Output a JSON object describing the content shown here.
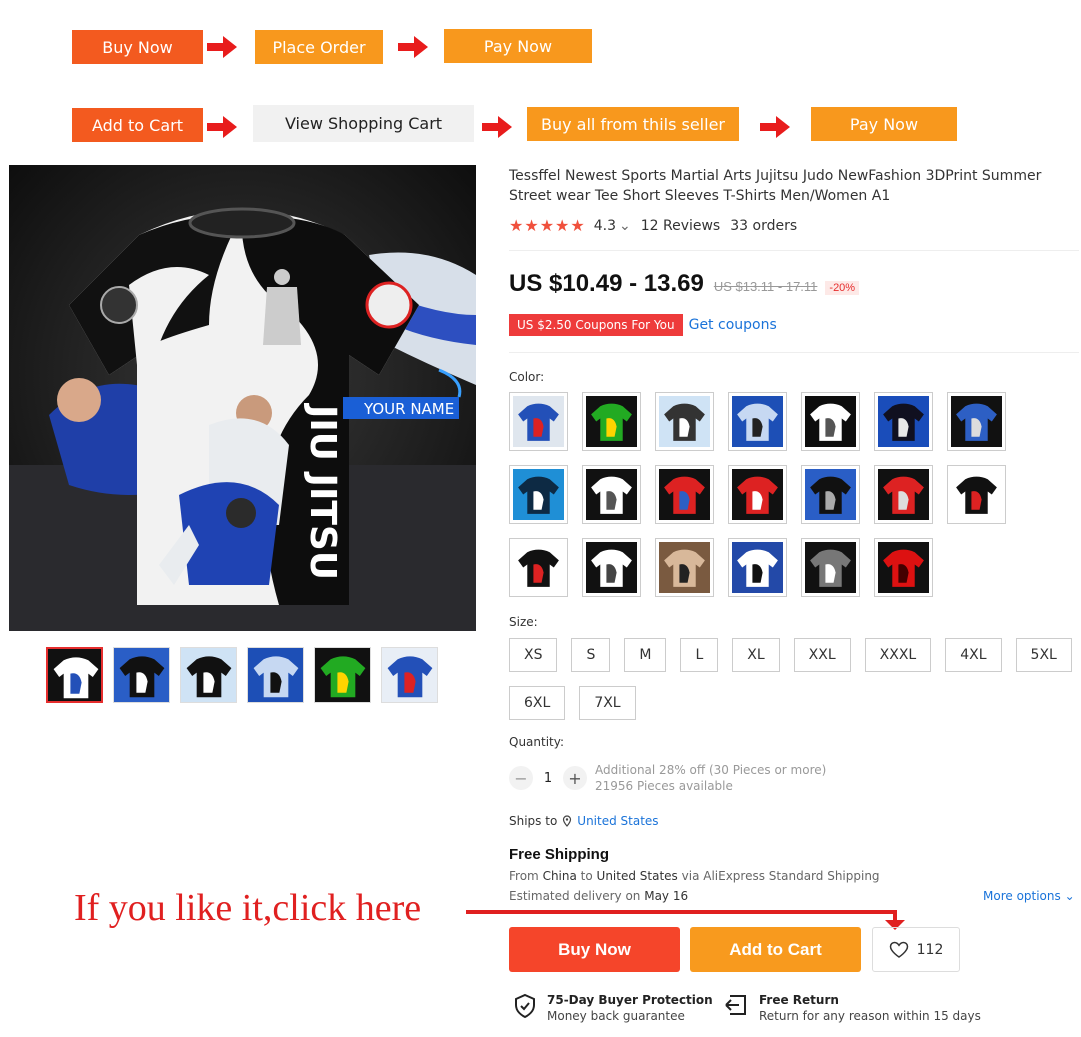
{
  "flow1": {
    "buy_now": "Buy Now",
    "place_order": "Place Order",
    "pay_now": "Pay Now"
  },
  "flow2": {
    "add_to_cart": "Add to Cart",
    "view_cart": "View Shopping Cart",
    "buy_all": "Buy all from thils seller",
    "pay_now": "Pay Now"
  },
  "product": {
    "title": "Tessffel Newest Sports Martial Arts Jujitsu Judo NewFashion 3DPrint Summer Street wear Tee Short Sleeves T-Shirts Men/Women A1",
    "stars": "★★★★★",
    "rating_value": "4.3",
    "rating_chevron": "⌄",
    "reviews": "12 Reviews",
    "orders": "33 orders",
    "price": "US $10.49 - 13.69",
    "old_price": "US $13.11 - 17.11",
    "discount": "-20%",
    "coupon": "US $2.50 Coupons For You",
    "get_coupons": "Get coupons"
  },
  "image_text": {
    "jiu_jitsu": "JIU JITSU",
    "your_name": "YOUR NAME"
  },
  "color_label": "Color:",
  "size_label": "Size:",
  "sizes": [
    "XS",
    "S",
    "M",
    "L",
    "XL",
    "XXL",
    "XXXL",
    "4XL",
    "5XL",
    "6XL",
    "7XL"
  ],
  "quantity": {
    "label": "Quantity:",
    "value": "1",
    "minus": "−",
    "plus": "+",
    "info1": "Additional 28% off (30 Pieces or more)",
    "info2": "21956 Pieces available"
  },
  "shipping": {
    "ships_to": "Ships to",
    "country": "United States",
    "free": "Free Shipping",
    "from_prefix": "From",
    "from_country": "China",
    "to_word": "to",
    "to_country": "United States",
    "via": "via AliExpress Standard Shipping",
    "est_prefix": "Estimated delivery on",
    "est_date": "May 16",
    "more_options": "More options ⌄"
  },
  "annotation": "If you like it,click here",
  "actions": {
    "buy_now": "Buy Now",
    "add_to_cart": "Add to Cart",
    "wishlist_count": "112"
  },
  "guarantees": [
    {
      "title": "75-Day Buyer Protection",
      "sub": "Money back guarantee"
    },
    {
      "title": "Free Return",
      "sub": "Return for any reason within 15 days"
    }
  ],
  "colors": {
    "flow_red": "#f35a1f",
    "flow_orange": "#f8981d",
    "buy_now_red": "#f5452a",
    "add_cart_orange": "#f89a1e",
    "coupon_red": "#ee3b3b",
    "link_blue": "#1a73d9",
    "annotation_red": "#e02020"
  },
  "swatches": [
    [
      "#dfe6ee",
      "#2350b8",
      "#d22"
    ],
    [
      "#111",
      "#2a2",
      "#ffd400"
    ],
    [
      "#cfe3f5",
      "#333",
      "#fff"
    ],
    [
      "#1d4fb6",
      "#c6d8f2",
      "#222"
    ],
    [
      "#0d0d0d",
      "#fff",
      "#555"
    ],
    [
      "#1a4dba",
      "#101020",
      "#e8e8e8"
    ],
    [
      "#111",
      "#2d5fc4",
      "#ddd"
    ],
    [
      "#1f8fd6",
      "#0d2a44",
      "#fff"
    ],
    [
      "#111",
      "#fff",
      "#555"
    ],
    [
      "#111",
      "#d22",
      "#2d5fc4"
    ],
    [
      "#111",
      "#d22",
      "#fff"
    ],
    [
      "#2a5ec6",
      "#111",
      "#aaa"
    ],
    [
      "#111",
      "#d22",
      "#ddd"
    ],
    [
      "#fff",
      "#111",
      "#d22"
    ],
    [
      "#fff",
      "#111",
      "#d22"
    ],
    [
      "#111",
      "#fff",
      "#444"
    ],
    [
      "#7a5a40",
      "#d8b89a",
      "#222"
    ],
    [
      "#2349a8",
      "#fff",
      "#111"
    ],
    [
      "#111",
      "#777",
      "#fff"
    ],
    [
      "#111",
      "#d11",
      "#400"
    ]
  ],
  "thumbs": [
    [
      "#111",
      "#fff",
      "#2350b8"
    ],
    [
      "#2a5ec6",
      "#111",
      "#fff"
    ],
    [
      "#cfe3f5",
      "#111",
      "#fff"
    ],
    [
      "#1d4fb6",
      "#c6d8f2",
      "#111"
    ],
    [
      "#111",
      "#2a2",
      "#ffd400"
    ],
    [
      "#e8eef6",
      "#2350b8",
      "#d22"
    ]
  ]
}
